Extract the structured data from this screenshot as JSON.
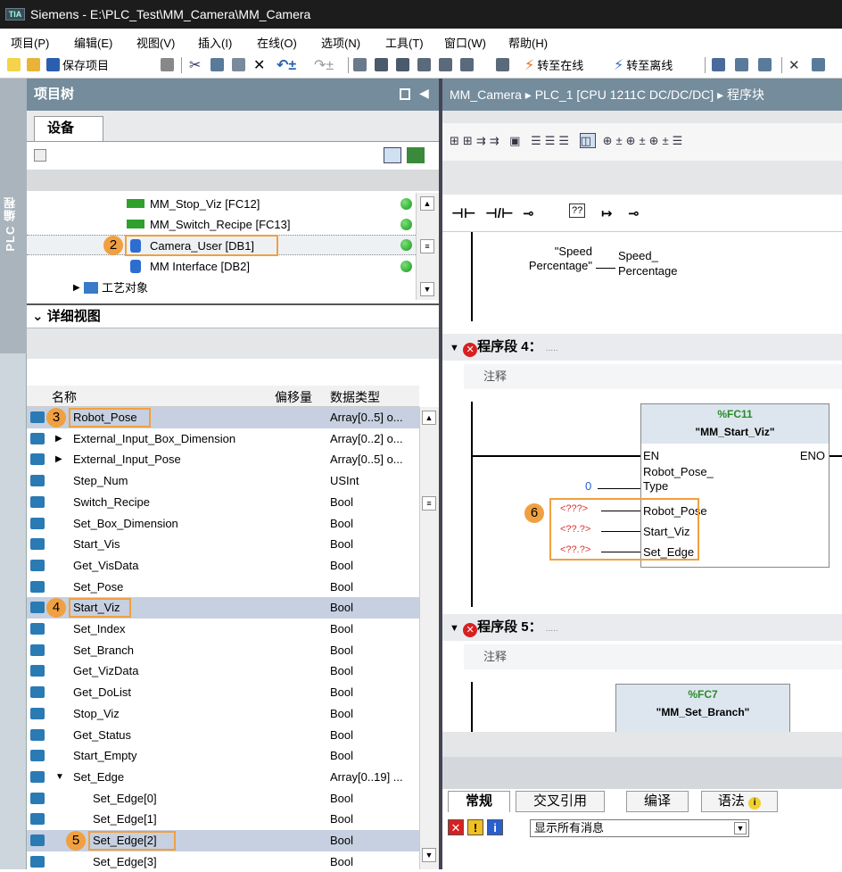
{
  "title": {
    "app": "Siemens",
    "path": "E:\\PLC_Test\\MM_Camera\\MM_Camera",
    "logo": "TIA"
  },
  "menu": [
    "项目(P)",
    "编辑(E)",
    "视图(V)",
    "插入(I)",
    "在线(O)",
    "选项(N)",
    "工具(T)",
    "窗口(W)",
    "帮助(H)"
  ],
  "toolbar": {
    "save_label": "保存项目",
    "go_online": "转至在线",
    "go_offline": "转至离线"
  },
  "left_strip": {
    "label": "PLC 编程"
  },
  "project_tree": {
    "header": "项目树",
    "tab": "设备",
    "items": [
      {
        "label": "MM_Stop_Viz [FC12]"
      },
      {
        "label": "MM_Switch_Recipe [FC13]"
      },
      {
        "label": "Camera_User [DB1]"
      },
      {
        "label": "MM Interface [DB2]"
      },
      {
        "label": "工艺对象"
      }
    ]
  },
  "detail_view": {
    "header": "详细视图",
    "columns": [
      "名称",
      "偏移量",
      "数据类型"
    ],
    "rows": [
      {
        "name": "Robot_Pose",
        "type": "Array[0..5] o..."
      },
      {
        "name": "External_Input_Box_Dimension",
        "type": "Array[0..2] o..."
      },
      {
        "name": "External_Input_Pose",
        "type": "Array[0..5] o..."
      },
      {
        "name": "Step_Num",
        "type": "USInt"
      },
      {
        "name": "Switch_Recipe",
        "type": "Bool"
      },
      {
        "name": "Set_Box_Dimension",
        "type": "Bool"
      },
      {
        "name": "Start_Vis",
        "type": "Bool"
      },
      {
        "name": "Get_VisData",
        "type": "Bool"
      },
      {
        "name": "Set_Pose",
        "type": "Bool"
      },
      {
        "name": "Start_Viz",
        "type": "Bool"
      },
      {
        "name": "Set_Index",
        "type": "Bool"
      },
      {
        "name": "Set_Branch",
        "type": "Bool"
      },
      {
        "name": "Get_VizData",
        "type": "Bool"
      },
      {
        "name": "Get_DoList",
        "type": "Bool"
      },
      {
        "name": "Stop_Viz",
        "type": "Bool"
      },
      {
        "name": "Get_Status",
        "type": "Bool"
      },
      {
        "name": "Start_Empty",
        "type": "Bool"
      },
      {
        "name": "Set_Edge",
        "type": "Array[0..19] ..."
      },
      {
        "name": "Set_Edge[0]",
        "type": "Bool"
      },
      {
        "name": "Set_Edge[1]",
        "type": "Bool"
      },
      {
        "name": "Set_Edge[2]",
        "type": "Bool"
      },
      {
        "name": "Set_Edge[3]",
        "type": "Bool"
      }
    ]
  },
  "badges": {
    "b2": "2",
    "b3": "3",
    "b4": "4",
    "b5": "5",
    "b6": "6"
  },
  "editor": {
    "breadcrumb": "MM_Camera ▸ PLC_1 [CPU 1211C DC/DC/DC] ▸ 程序块",
    "speed_tag": "\"Speed\nPercentage\"",
    "speed_param": "Speed_\nPercentage",
    "seg4_title": "程序段 4：",
    "seg4_dots": ".....",
    "comment": "注释",
    "fc11": {
      "num": "%FC11",
      "name": "\"MM_Start_Viz\"",
      "en": "EN",
      "eno": "ENO",
      "p1": "Robot_Pose_\nType",
      "p1_val": "0",
      "p2": "Robot_Pose",
      "p2_val": "<???>",
      "p3": "Start_Viz",
      "p3_val": "<??.?>",
      "p4": "Set_Edge",
      "p4_val": "<??.?>"
    },
    "seg5_title": "程序段 5：",
    "seg5_dots": ".....",
    "fc7": {
      "num": "%FC7",
      "name": "\"MM_Set_Branch\""
    },
    "ladder_icons": [
      "⊣⊢",
      "⊣/⊢",
      "⊸",
      "??",
      "↦",
      "⊸"
    ]
  },
  "messages": {
    "tabs": [
      "常规",
      "交叉引用",
      "编译",
      "语法"
    ],
    "filter": "显示所有消息"
  }
}
